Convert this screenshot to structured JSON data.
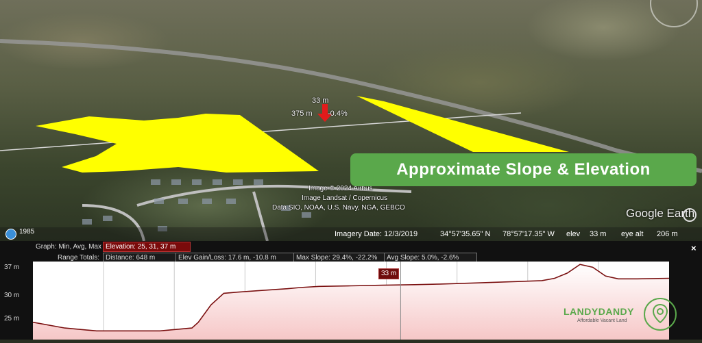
{
  "map": {
    "marker_elev": "33 m",
    "marker_dist": "375 m",
    "marker_slope": "-0.4%",
    "imagery_credits": [
      "Image © 2024 Airbus",
      "Image Landsat / Copernicus",
      "Data SIO, NOAA, U.S. Navy, NGA, GEBCO"
    ],
    "banner": "Approximate Slope & Elevation",
    "logo": "Google Earth",
    "history_year": "1985",
    "polygon_color": "#ffff00"
  },
  "status_bar": {
    "imagery_date": "Imagery Date: 12/3/2019",
    "latitude": "34°57'35.65\" N",
    "longitude": "78°57'17.35\" W",
    "elev_label": "elev",
    "elev_value": "33 m",
    "eye_alt_label": "eye alt",
    "eye_alt_value": "206 m"
  },
  "elevation_profile": {
    "graph_label": "Graph: Min, Avg, Max",
    "elevation": "Elevation: 25, 31, 37 m",
    "range_totals_label": "Range Totals:",
    "distance": "Distance: 648 m",
    "elev_gain_loss": "Elev Gain/Loss: 17.6 m, -10.8 m",
    "max_slope": "Max Slope: 29.4%, -22.2%",
    "avg_slope": "Avg Slope: 5.0%, -2.6%",
    "close_label": "×",
    "y_labels": [
      "37 m",
      "30 m",
      "25 m"
    ],
    "cursor_label": "33 m",
    "line_color": "#7a1010",
    "fill_color": "#f6c7c7"
  },
  "watermark": {
    "brand": "LANDYDANDY",
    "tagline": "Affordable Vacant Land",
    "color": "#5aa84b"
  },
  "chart_data": {
    "type": "area",
    "ylim": [
      24,
      37.5
    ],
    "x": [
      0,
      5,
      10,
      15,
      20,
      25,
      26,
      28,
      30,
      32,
      36,
      40,
      42,
      45,
      50,
      55,
      60,
      64,
      70,
      75,
      80,
      82,
      84,
      86,
      88,
      90,
      92,
      95,
      100
    ],
    "y": [
      27,
      26,
      25.5,
      25.5,
      25.5,
      26,
      27,
      30,
      32,
      32.2,
      32.5,
      32.8,
      33,
      33.2,
      33.3,
      33.4,
      33.5,
      33.6,
      33.8,
      34.0,
      34.2,
      34.6,
      35.5,
      37,
      36.5,
      35,
      34.5,
      34.5,
      34.6
    ],
    "ylabels": [
      "37 m",
      "30 m",
      "25 m"
    ],
    "grid_lines_x": 9
  }
}
